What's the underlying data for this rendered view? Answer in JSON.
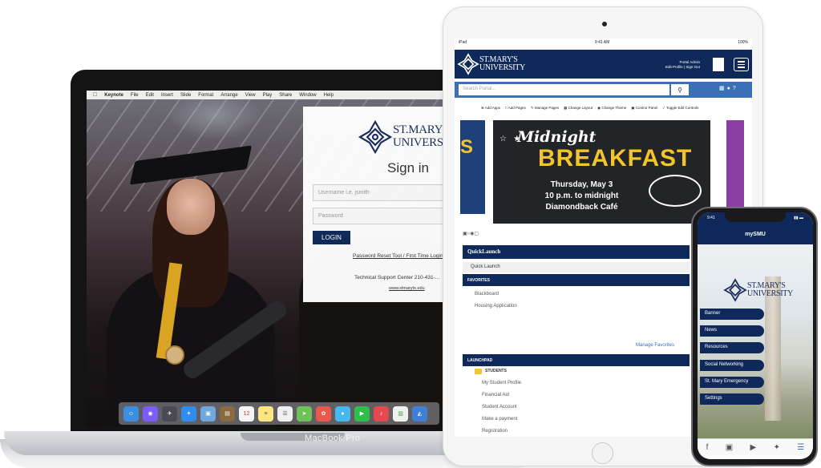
{
  "macbook": {
    "brand": "MacBook Pro",
    "menubar": [
      "Keynote",
      "File",
      "Edit",
      "Insert",
      "Slide",
      "Format",
      "Arrange",
      "View",
      "Play",
      "Share",
      "Window",
      "Help"
    ],
    "signin": {
      "logo_line1": "ST.MARY'S",
      "logo_line2": "UNIVERSITY",
      "title": "Sign in",
      "username_placeholder": "Username i.e. jsmith",
      "password_placeholder": "Password",
      "login_label": "LOGIN",
      "reset_link": "Password Reset Tool / First Time Login",
      "support_text": "Technical Support Center 210-431-...",
      "site_url": "www.stmarytx.edu"
    }
  },
  "ipad": {
    "status_left": "iPad",
    "status_time": "9:41 AM",
    "status_right": "100%",
    "logo_line1": "ST.MARY'S",
    "logo_line2": "UNIVERSITY",
    "admin_name": "Portal Admin",
    "admin_links": "Edit Profile | Sign Out",
    "search_placeholder": "Search Portal...",
    "tools": [
      "Add Apps",
      "Add Pages",
      "Manage Pages",
      "Change Layout",
      "Change Theme",
      "Control Panel",
      "Toggle Edit Controls"
    ],
    "banner": {
      "title1": "Midnight",
      "title2": "BREAKFAST",
      "line1": "Thursday, May 3",
      "line2": "10 p.m. to midnight",
      "line3": "Diamondback Café"
    },
    "quicklaunch": {
      "header": "QuickLaunch",
      "item": "Quick Launch"
    },
    "favorites": {
      "header": "FAVORITES",
      "items": [
        "Blackboard",
        "Housing Application"
      ],
      "manage": "Manage Favorites"
    },
    "launchpad": {
      "header": "LAUNCHPAD",
      "folder": "STUDENTS",
      "items": [
        "My Student Profile",
        "Financial Aid",
        "Student Account",
        "Make a payment",
        "Registration"
      ]
    }
  },
  "iphone": {
    "status_time": "9:41",
    "title": "mySMU",
    "logo_line1": "ST.MARY'S",
    "logo_line2": "UNIVERSITY",
    "menu": [
      "Banner",
      "News",
      "Resources",
      "Social Networking",
      "St. Mary Emergency",
      "Settings"
    ],
    "tab_icons": [
      "facebook-icon",
      "instagram-icon",
      "youtube-icon",
      "twitter-icon",
      "menu-icon"
    ]
  },
  "colors": {
    "navy": "#0f2a5a",
    "blue": "#3b6fb6",
    "gold": "#f2c629",
    "purple": "#8c3fa3"
  }
}
